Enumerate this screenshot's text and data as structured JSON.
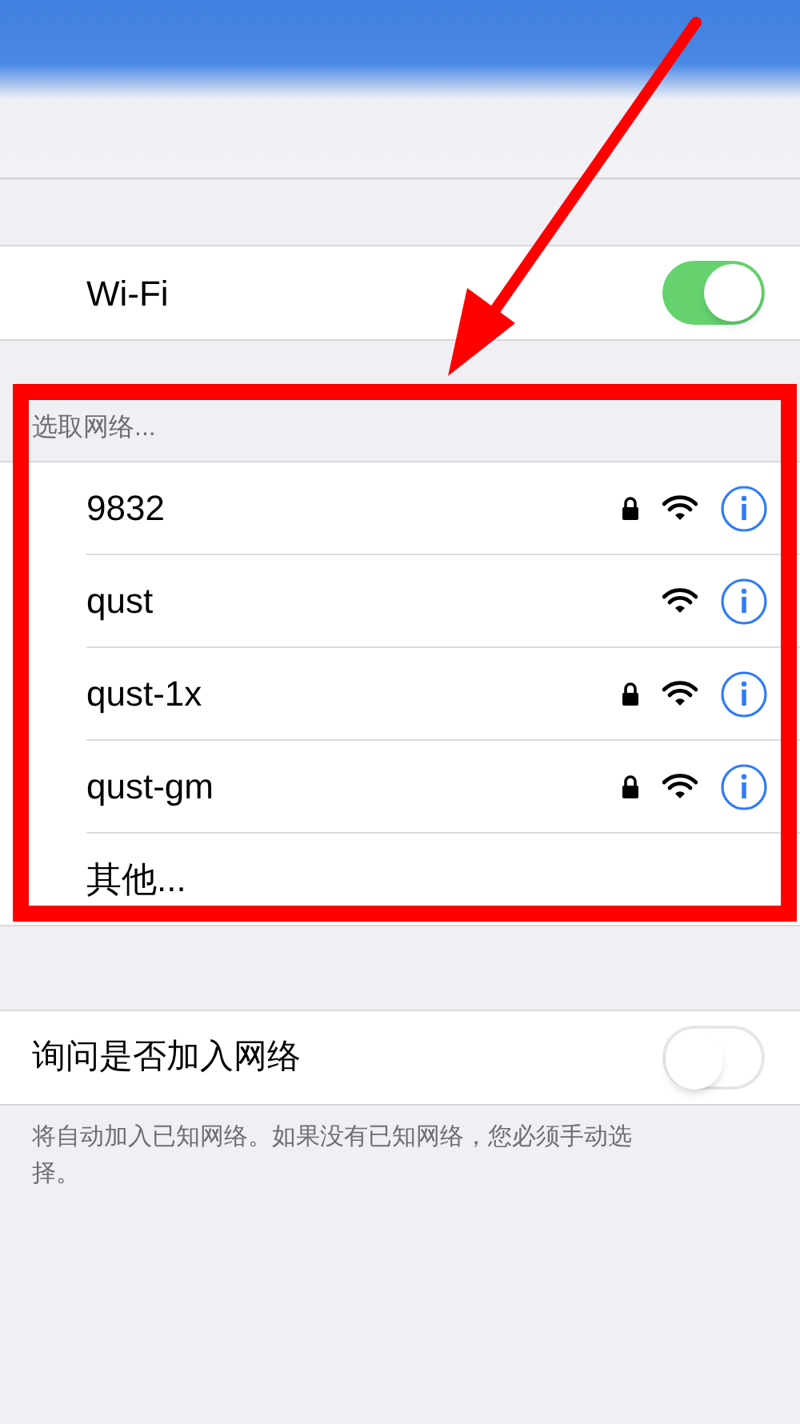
{
  "wifi_row": {
    "label": "Wi-Fi",
    "on": true
  },
  "networks_section": {
    "header": "选取网络...",
    "networks": [
      {
        "kind": "network",
        "name": "9832",
        "locked": true
      },
      {
        "kind": "network",
        "name": "qust",
        "locked": false
      },
      {
        "kind": "network",
        "name": "qust-1x",
        "locked": true
      },
      {
        "kind": "network",
        "name": "qust-gm",
        "locked": true
      },
      {
        "kind": "other",
        "name": "其他..."
      }
    ]
  },
  "ask_to_join": {
    "label": "询问是否加入网络",
    "on": false,
    "footer": "将自动加入已知网络。如果没有已知网络，您必须手动选择。"
  }
}
